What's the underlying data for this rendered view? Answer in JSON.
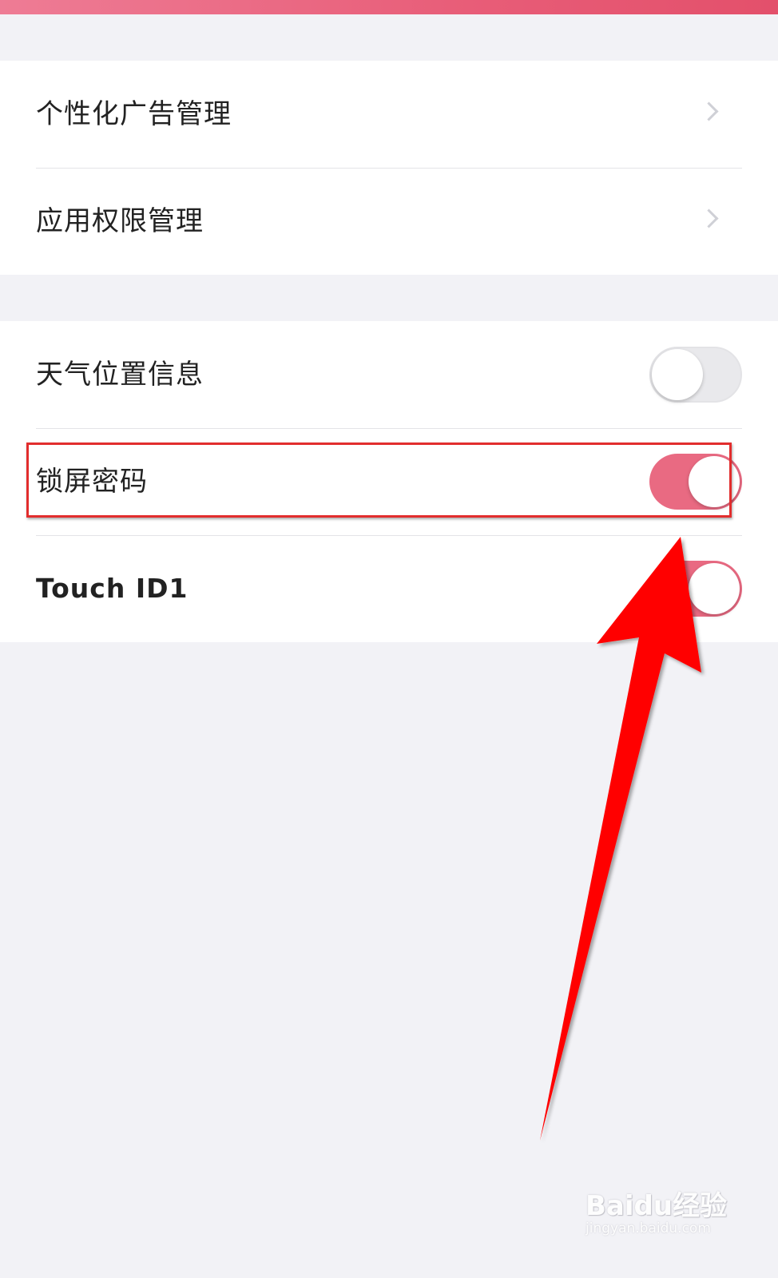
{
  "settings_group_1": {
    "items": [
      {
        "label": "个性化广告管理",
        "icon": "chevron-right-icon"
      },
      {
        "label": "应用权限管理",
        "icon": "chevron-right-icon"
      }
    ]
  },
  "settings_group_2": {
    "items": [
      {
        "label": "天气位置信息",
        "toggle_on": false
      },
      {
        "label": "锁屏密码",
        "toggle_on": true
      },
      {
        "label": "Touch ID1",
        "toggle_on": true
      }
    ]
  },
  "colors": {
    "accent": "#e96a82",
    "annotation_red": "#ff0000"
  },
  "watermark": {
    "logo": "Baidu经验",
    "url": "jingyan.baidu.com"
  }
}
